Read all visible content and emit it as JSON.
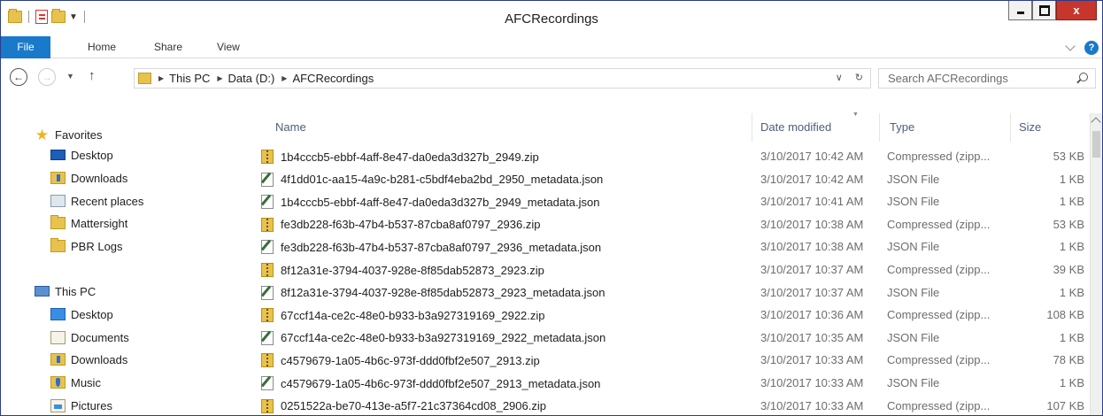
{
  "window": {
    "title": "AFCRecordings"
  },
  "ribbon": {
    "tabs": [
      {
        "label": "File",
        "active": true
      },
      {
        "label": "Home"
      },
      {
        "label": "Share"
      },
      {
        "label": "View"
      }
    ],
    "help_icon": "?"
  },
  "address": {
    "breadcrumbs": [
      "This PC",
      "Data (D:)",
      "AFCRecordings"
    ],
    "search_placeholder": "Search AFCRecordings"
  },
  "nav_pane": {
    "favorites_label": "Favorites",
    "favorites": [
      {
        "label": "Desktop",
        "icon": "desktop-icon"
      },
      {
        "label": "Downloads",
        "icon": "downloads-icon"
      },
      {
        "label": "Recent places",
        "icon": "recent-places-icon"
      },
      {
        "label": "Mattersight",
        "icon": "folder-icon"
      },
      {
        "label": "PBR Logs",
        "icon": "folder-icon"
      }
    ],
    "this_pc_label": "This PC",
    "this_pc_items": [
      {
        "label": "Desktop",
        "icon": "desktop-folder-icon"
      },
      {
        "label": "Documents",
        "icon": "documents-icon"
      },
      {
        "label": "Downloads",
        "icon": "downloads-icon"
      },
      {
        "label": "Music",
        "icon": "music-icon"
      },
      {
        "label": "Pictures",
        "icon": "pictures-icon"
      }
    ]
  },
  "file_list": {
    "columns": [
      "Name",
      "Date modified",
      "Type",
      "Size"
    ],
    "rows": [
      {
        "name": "1b4cccb5-ebbf-4aff-8e47-da0eda3d327b_2949.zip",
        "date": "3/10/2017 10:42 AM",
        "type": "Compressed (zipp...",
        "size": "53 KB",
        "kind": "zip"
      },
      {
        "name": "4f1dd01c-aa15-4a9c-b281-c5bdf4eba2bd_2950_metadata.json",
        "date": "3/10/2017 10:42 AM",
        "type": "JSON File",
        "size": "1 KB",
        "kind": "json"
      },
      {
        "name": "1b4cccb5-ebbf-4aff-8e47-da0eda3d327b_2949_metadata.json",
        "date": "3/10/2017 10:41 AM",
        "type": "JSON File",
        "size": "1 KB",
        "kind": "json"
      },
      {
        "name": "fe3db228-f63b-47b4-b537-87cba8af0797_2936.zip",
        "date": "3/10/2017 10:38 AM",
        "type": "Compressed (zipp...",
        "size": "53 KB",
        "kind": "zip"
      },
      {
        "name": "fe3db228-f63b-47b4-b537-87cba8af0797_2936_metadata.json",
        "date": "3/10/2017 10:38 AM",
        "type": "JSON File",
        "size": "1 KB",
        "kind": "json"
      },
      {
        "name": "8f12a31e-3794-4037-928e-8f85dab52873_2923.zip",
        "date": "3/10/2017 10:37 AM",
        "type": "Compressed (zipp...",
        "size": "39 KB",
        "kind": "zip"
      },
      {
        "name": "8f12a31e-3794-4037-928e-8f85dab52873_2923_metadata.json",
        "date": "3/10/2017 10:37 AM",
        "type": "JSON File",
        "size": "1 KB",
        "kind": "json"
      },
      {
        "name": "67ccf14a-ce2c-48e0-b933-b3a927319169_2922.zip",
        "date": "3/10/2017 10:36 AM",
        "type": "Compressed (zipp...",
        "size": "108 KB",
        "kind": "zip"
      },
      {
        "name": "67ccf14a-ce2c-48e0-b933-b3a927319169_2922_metadata.json",
        "date": "3/10/2017 10:35 AM",
        "type": "JSON File",
        "size": "1 KB",
        "kind": "json"
      },
      {
        "name": "c4579679-1a05-4b6c-973f-ddd0fbf2e507_2913.zip",
        "date": "3/10/2017 10:33 AM",
        "type": "Compressed (zipp...",
        "size": "78 KB",
        "kind": "zip"
      },
      {
        "name": "c4579679-1a05-4b6c-973f-ddd0fbf2e507_2913_metadata.json",
        "date": "3/10/2017 10:33 AM",
        "type": "JSON File",
        "size": "1 KB",
        "kind": "json"
      },
      {
        "name": "0251522a-be70-413e-a5f7-21c37364cd08_2906.zip",
        "date": "3/10/2017 10:33 AM",
        "type": "Compressed (zipp...",
        "size": "107 KB",
        "kind": "zip"
      }
    ]
  },
  "colors": {
    "accent": "#1979ca",
    "close": "#c7362c",
    "folder": "#e8c24e"
  }
}
